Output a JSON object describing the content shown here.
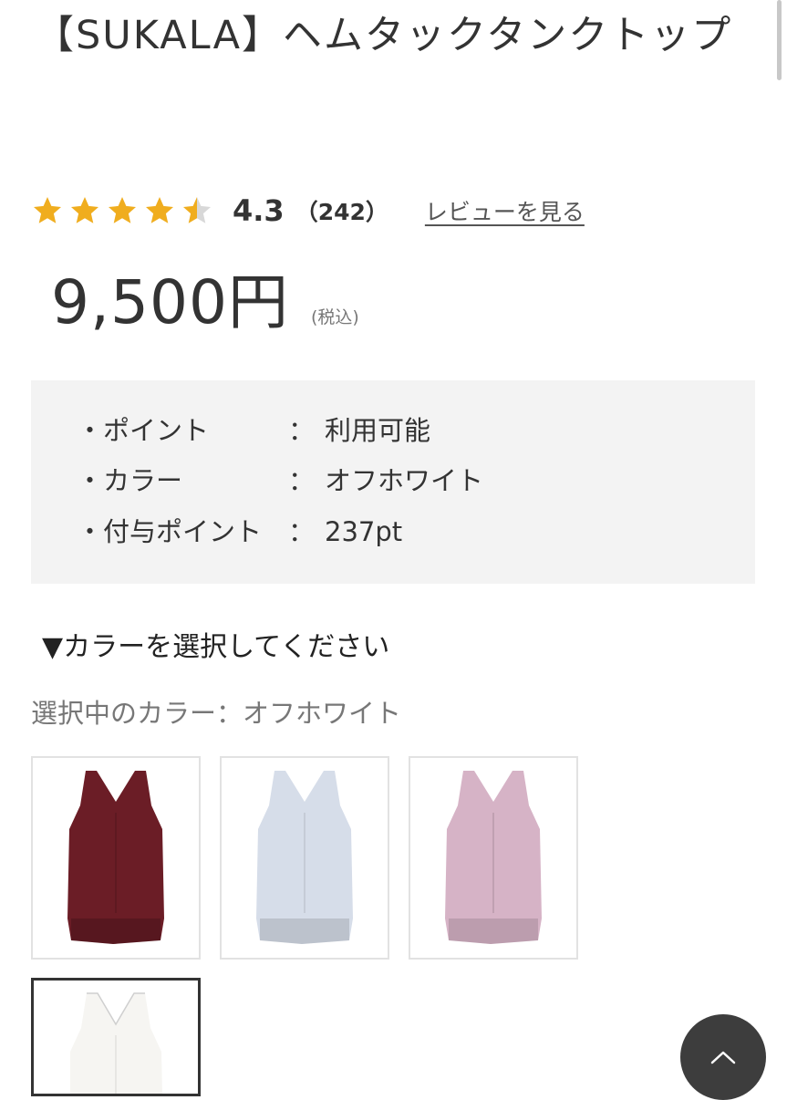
{
  "product": {
    "title": "【SUKALA】ヘムタックタンクトップ",
    "rating": {
      "stars": 4.3,
      "score": "4.3",
      "count": "（242）",
      "review_link": "レビューを見る",
      "star_color": "#f0ad1e",
      "star_empty_color": "#d8d8d8"
    },
    "price": "9,500円",
    "tax_note": "(税込)"
  },
  "info": [
    {
      "label": "・ポイント",
      "colon": "：",
      "value": "利用可能"
    },
    {
      "label": "・カラー",
      "colon": "：",
      "value": "オフホワイト"
    },
    {
      "label": "・付与ポイント",
      "colon": "：",
      "value": "237pt"
    }
  ],
  "color_select": {
    "heading": "▼カラーを選択してください",
    "selected_text": "選択中のカラー：オフホワイト",
    "swatches": [
      {
        "color": "#6b1d26"
      },
      {
        "color": "#d6dde9"
      },
      {
        "color": "#d6b3c6"
      },
      {
        "color": "#f6f5f2",
        "selected": true
      }
    ]
  },
  "back_to_top": {
    "icon": "chevron-up-icon"
  }
}
